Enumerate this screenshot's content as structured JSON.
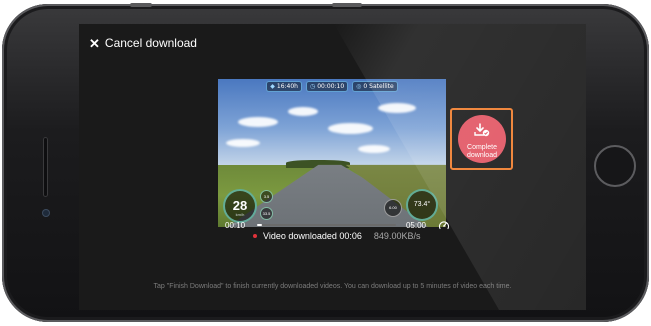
{
  "header": {
    "cancel_label": "Cancel download",
    "cancel_icon": "close-icon"
  },
  "video": {
    "hud": {
      "timestamp_left": "16:40h",
      "timestamp_mid": "00:00:10",
      "gps": "0 Satellite"
    },
    "speed_value": "28",
    "speed_unit": "km/h",
    "mini_dials": [
      "3.5",
      "33.5"
    ],
    "gauge_small": "6.00",
    "gauge_right": "73.4°"
  },
  "complete_button": {
    "label_line1": "Complete",
    "label_line2": "download",
    "icon": "download-check-icon",
    "color": "#e25563",
    "highlight_color": "#ef7d2d"
  },
  "progress": {
    "current_time": "00:10",
    "total_time": "05:00",
    "fraction": 0.033,
    "speed_icon": "speedometer-icon"
  },
  "status": {
    "text": "Video downloaded 00:06",
    "rate": "849.00KB/s",
    "dot_color": "#e0323a"
  },
  "footer": {
    "hint": "Tap \"Finish Download\" to finish currently downloaded videos.  You can download up to 5 minutes of video each time."
  }
}
